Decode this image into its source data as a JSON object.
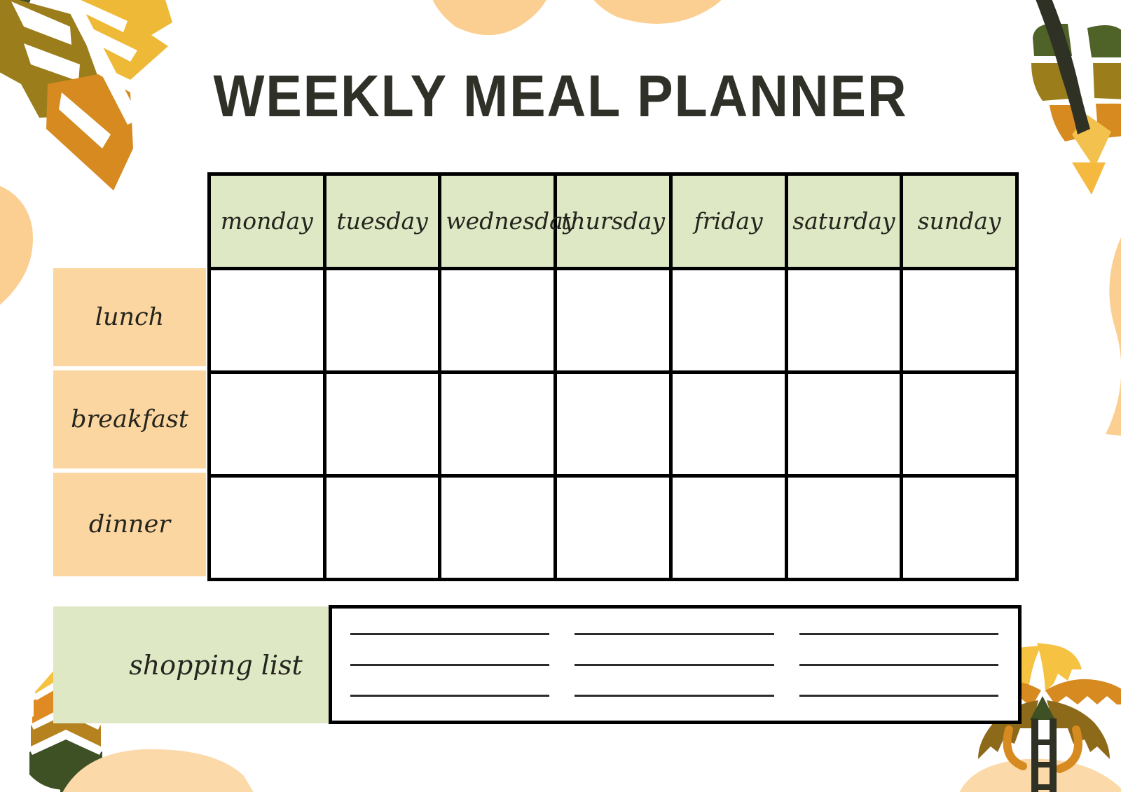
{
  "page": {
    "title": "WEEKLY MEAL PLANNER",
    "background": "#ffffff"
  },
  "colors": {
    "header_green": "#dfe8c4",
    "row_peach": "#fcd6a0",
    "ink": "#2f3128",
    "grid_line": "#000000",
    "leaf_yellow": "#eeb937",
    "leaf_gold": "#f2c14e",
    "leaf_orange": "#d68a20",
    "leaf_olive": "#9b7e1b",
    "leaf_green": "#4f6228",
    "leaf_dark": "#2e3123",
    "blob_peach": "#fbcf91",
    "blob_light_peach": "#fcd9a8"
  },
  "table": {
    "columns": [
      {
        "label": "monday"
      },
      {
        "label": "tuesday"
      },
      {
        "label": "wednesday"
      },
      {
        "label": "thursday"
      },
      {
        "label": "friday"
      },
      {
        "label": "saturday"
      },
      {
        "label": "sunday"
      }
    ],
    "rows": [
      {
        "label": "lunch"
      },
      {
        "label": "breakfast"
      },
      {
        "label": "dinner"
      }
    ],
    "cells": [
      [
        "",
        "",
        "",
        "",
        "",
        "",
        ""
      ],
      [
        "",
        "",
        "",
        "",
        "",
        "",
        ""
      ],
      [
        "",
        "",
        "",
        "",
        "",
        "",
        ""
      ]
    ]
  },
  "shopping": {
    "label": "shopping list",
    "line_rows": 3,
    "line_columns": 3,
    "lines": [
      [
        "",
        "",
        ""
      ],
      [
        "",
        "",
        ""
      ],
      [
        "",
        "",
        ""
      ]
    ]
  },
  "decorations": [
    {
      "name": "autumn-leaves-cluster",
      "position": "top-left"
    },
    {
      "name": "peach-blob",
      "position": "top-center-left"
    },
    {
      "name": "peach-blob",
      "position": "top-center-right"
    },
    {
      "name": "peach-blob",
      "position": "left-edge"
    },
    {
      "name": "segmented-leaf",
      "position": "top-right"
    },
    {
      "name": "peach-blob",
      "position": "right-edge"
    },
    {
      "name": "wheat-stalk",
      "position": "bottom-left"
    },
    {
      "name": "peach-blob",
      "position": "bottom-left-ground"
    },
    {
      "name": "palm-tree",
      "position": "bottom-right"
    },
    {
      "name": "peach-blob",
      "position": "bottom-right-ground"
    }
  ]
}
